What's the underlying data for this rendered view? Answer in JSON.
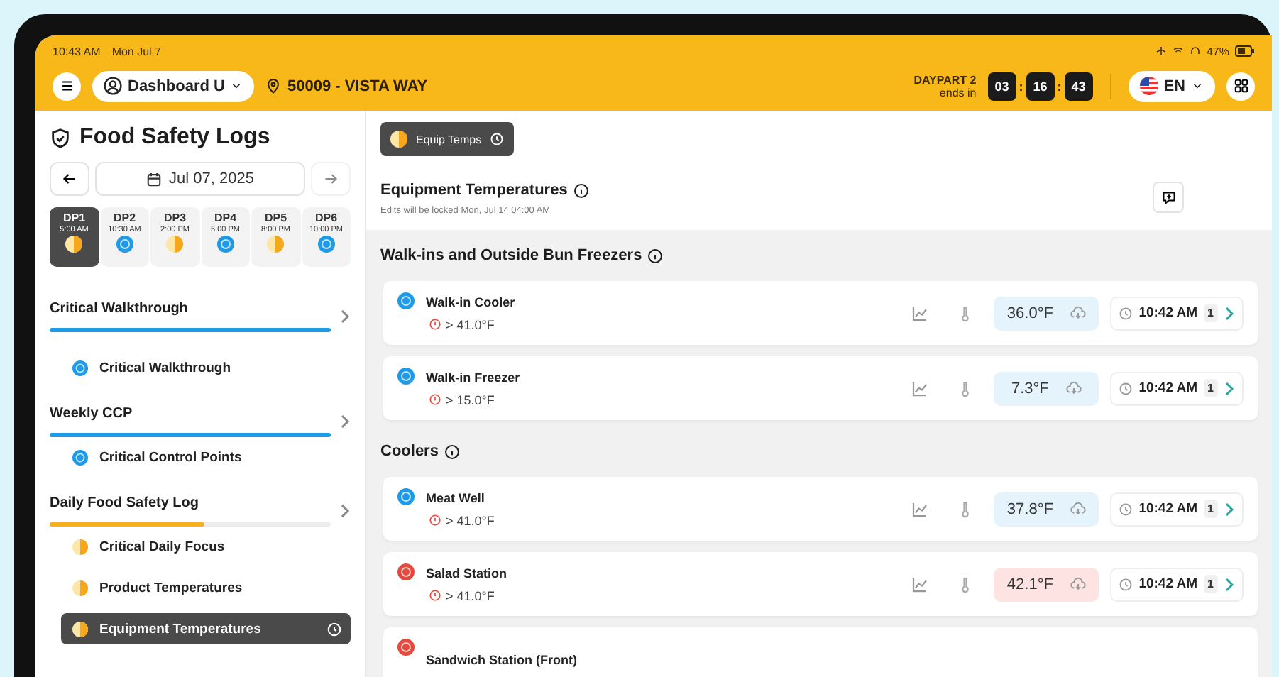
{
  "status_bar": {
    "time": "10:43 AM",
    "date": "Mon Jul 7",
    "battery": "47%"
  },
  "header": {
    "user": "Dashboard U",
    "location": "50009 - VISTA WAY",
    "daypart_label": "DAYPART 2",
    "daypart_sub": "ends in",
    "countdown": [
      "03",
      "16",
      "43"
    ],
    "countdown_separator": ":",
    "language": "EN"
  },
  "sidebar": {
    "title": "Food Safety Logs",
    "date": "Jul 07, 2025",
    "dayparts": [
      {
        "label": "DP1",
        "time": "5:00 AM",
        "kind": "partial",
        "selected": true
      },
      {
        "label": "DP2",
        "time": "10:30 AM",
        "kind": "complete",
        "selected": false
      },
      {
        "label": "DP3",
        "time": "2:00 PM",
        "kind": "partial",
        "selected": false
      },
      {
        "label": "DP4",
        "time": "5:00 PM",
        "kind": "complete",
        "selected": false
      },
      {
        "label": "DP5",
        "time": "8:00 PM",
        "kind": "partial",
        "selected": false
      },
      {
        "label": "DP6",
        "time": "10:00 PM",
        "kind": "complete",
        "selected": false
      }
    ],
    "sections": [
      {
        "title": "Critical Walkthrough",
        "level": 1,
        "color": "#1e9be8",
        "items": [
          {
            "label": "Critical Walkthrough",
            "kind": "complete",
            "selected": false
          }
        ]
      },
      {
        "title": "Weekly CCP",
        "level": 1,
        "color": "#1e9be8",
        "items": [
          {
            "label": "Critical Control Points",
            "kind": "complete",
            "selected": false
          }
        ]
      },
      {
        "title": "Daily Food Safety Log",
        "level": 0.55,
        "color": "#f5b01c",
        "items": [
          {
            "label": "Critical Daily Focus",
            "kind": "partial",
            "selected": false
          },
          {
            "label": "Product Temperatures",
            "kind": "partial",
            "selected": false
          },
          {
            "label": "Equipment Temperatures",
            "kind": "partial",
            "selected": true
          }
        ]
      }
    ]
  },
  "main": {
    "chip": "Equip Temps",
    "title": "Equipment Temperatures",
    "subtitle": "Edits will be locked Mon, Jul 14 04:00 AM",
    "groups": [
      {
        "title": "Walk-ins and Outside Bun Freezers",
        "rows": [
          {
            "name": "Walk-in Cooler",
            "limit": "> 41.0°F",
            "kind": "complete",
            "temp": "36.0°F",
            "time": "10:42 AM",
            "count": "1"
          },
          {
            "name": "Walk-in Freezer",
            "limit": "> 15.0°F",
            "kind": "complete",
            "temp": "7.3°F",
            "time": "10:42 AM",
            "count": "1"
          }
        ]
      },
      {
        "title": "Coolers",
        "rows": [
          {
            "name": "Meat Well",
            "limit": "> 41.0°F",
            "kind": "complete",
            "temp": "37.8°F",
            "time": "10:42 AM",
            "count": "1"
          },
          {
            "name": "Salad Station",
            "limit": "> 41.0°F",
            "kind": "failed",
            "temp": "42.1°F",
            "time": "10:42 AM",
            "count": "1"
          },
          {
            "name": "Sandwich Station (Front)",
            "kind": "failed"
          }
        ]
      }
    ]
  }
}
